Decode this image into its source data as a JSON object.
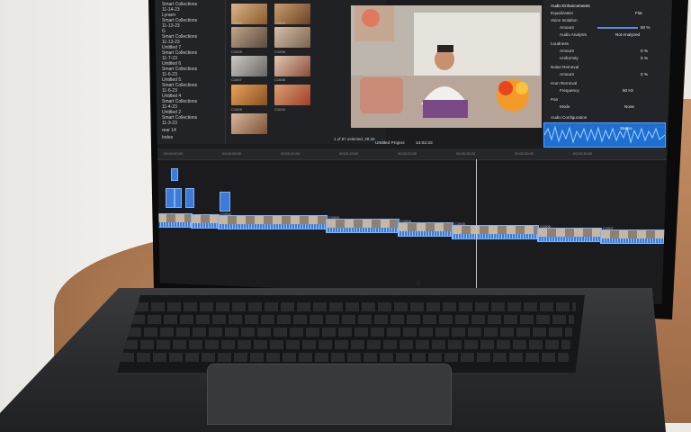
{
  "sidebar": {
    "items": [
      "Smart Collections",
      "11-14-23",
      "Lyraen",
      "Smart Collections",
      "11-13-23",
      "G",
      "Smart Collections",
      "11-13-23",
      "Untitled 7",
      "Smart Collections",
      "11-7-23",
      "Untitled 6",
      "Smart Collections",
      "11-6-23",
      "Untitled 5",
      "Smart Collections",
      "11-6-23",
      "Untitled 4",
      "Smart Collections",
      "11-4-23",
      "Untitled 2",
      "Smart Collections",
      "11-3-23",
      "rear 14",
      "Index"
    ]
  },
  "browser": {
    "clip_labels": [
      "C1003",
      "C1004",
      "C1005",
      "C1006",
      "C1007",
      "C1008",
      "C1009",
      "C1010"
    ],
    "footer": "1 of 87 selected, 28:28"
  },
  "timeline": {
    "project": "Untitled Project",
    "timecode": "14:02:23",
    "ruler": [
      "00:00:00:00",
      "00:00:05:00",
      "00:00:10:00",
      "00:00:15:00",
      "00:00:20:00",
      "00:00:25:00",
      "00:00:30:00",
      "00:00:35:00"
    ],
    "clip_labels": [
      "C1002",
      "C1003",
      "C1004",
      "C1005",
      "C1006",
      "C1007",
      "C1008"
    ]
  },
  "inspector": {
    "section": "Audio Enhancements",
    "rows": [
      {
        "label": "Equalization",
        "value": "Flat"
      },
      {
        "label": "Voice Isolation",
        "value": ""
      },
      {
        "label": "Amount",
        "value": "50 %"
      },
      {
        "label": "Audio Analysis",
        "value": "Not Analyzed"
      },
      {
        "label": "Loudness",
        "value": ""
      },
      {
        "label": "Amount",
        "value": "0 %"
      },
      {
        "label": "Uniformity",
        "value": "0 %"
      },
      {
        "label": "Noise Removal",
        "value": ""
      },
      {
        "label": "Amount",
        "value": "0 %"
      },
      {
        "label": "Hum Removal",
        "value": ""
      },
      {
        "label": "Frequency",
        "value": "50 Hz"
      },
      {
        "label": "Pan",
        "value": ""
      },
      {
        "label": "Mode",
        "value": "None"
      }
    ],
    "audio_config": "Audio Configuration",
    "stereo": "Stereo",
    "dialogue": "Dialogue-1",
    "button": "Save Effects Preset"
  },
  "colors": {
    "accent": "#2f7ee0",
    "bg_dark": "#1c1c1e"
  }
}
